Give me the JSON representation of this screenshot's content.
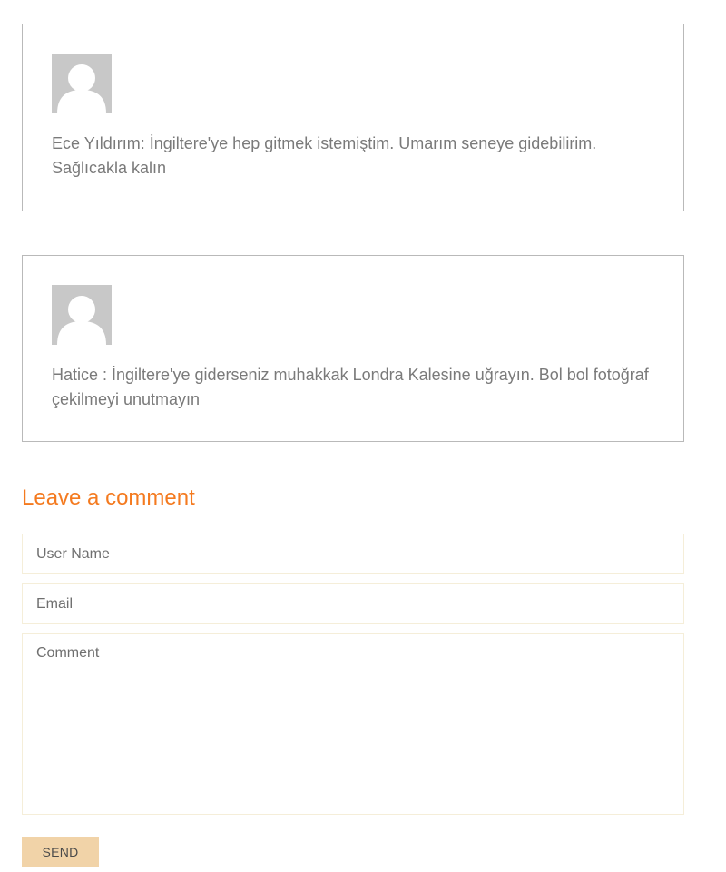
{
  "comments": [
    {
      "avatar_icon": "user-silhouette-icon",
      "text": "Ece Yıldırım: İngiltere'ye hep gitmek istemiştim. Umarım seneye gidebilirim. Sağlıcakla kalın"
    },
    {
      "avatar_icon": "user-silhouette-icon",
      "text": "Hatice : İngiltere'ye giderseniz muhakkak Londra Kalesine uğrayın. Bol bol fotoğraf çekilmeyi unutmayın"
    }
  ],
  "form": {
    "title": "Leave a comment",
    "username_placeholder": "User Name",
    "username_value": "",
    "email_placeholder": "Email",
    "email_value": "",
    "comment_placeholder": "Comment",
    "comment_value": "",
    "send_label": "SEND"
  },
  "colors": {
    "accent": "#f47a1f",
    "button_bg": "#f1d3a8",
    "card_border": "#b9b9b9",
    "input_border": "#f5eed9",
    "avatar_bg": "#c8c8c8"
  }
}
